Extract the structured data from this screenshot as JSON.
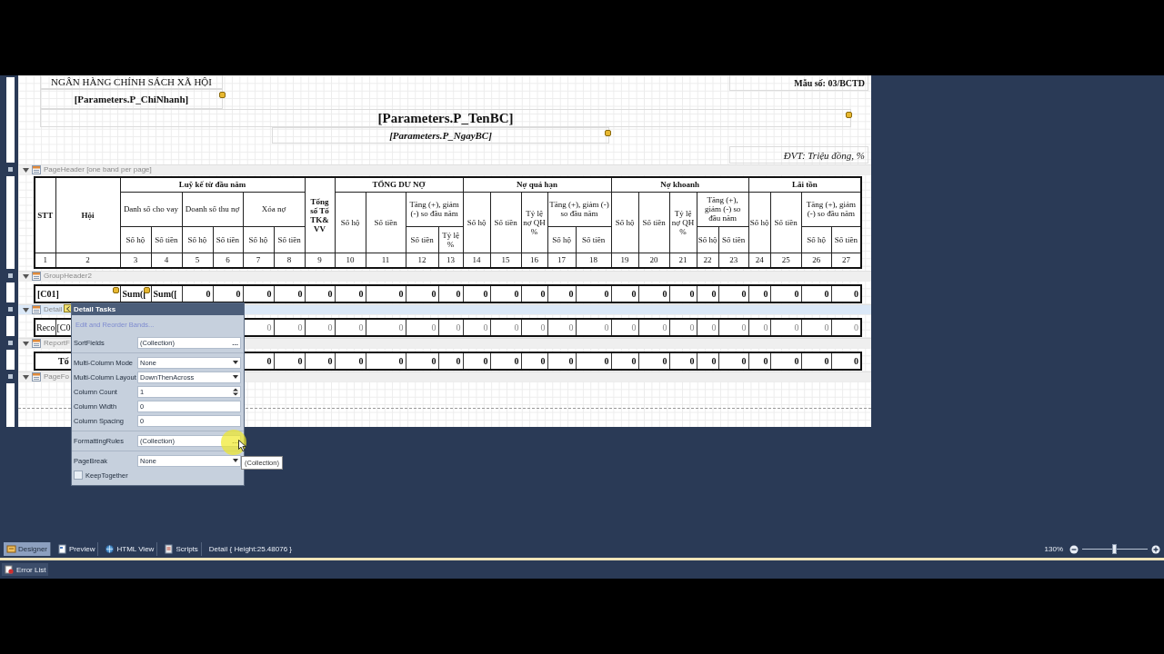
{
  "report_header": {
    "bank_name": "NGÂN HÀNG CHÍNH SÁCH XÃ HỘI",
    "branch": "[Parameters.P_ChiNhanh]",
    "form_number": "Mẫu số: 03/BCTD",
    "title": "[Parameters.P_TenBC]",
    "date": "[Parameters.P_NgayBC]",
    "unit": "ĐVT: Triệu đồng, %"
  },
  "table": {
    "columns": [
      {
        "label": "STT"
      },
      {
        "label": "Hội"
      },
      {
        "label": "Luỹ kế từ đầu năm",
        "children": [
          {
            "label": "Danh số cho vay",
            "children": [
              {
                "label": "Số hộ"
              },
              {
                "label": "Số tiền"
              }
            ]
          },
          {
            "label": "Doanh số thu nợ",
            "children": [
              {
                "label": "Số hộ"
              },
              {
                "label": "Số tiền"
              }
            ]
          },
          {
            "label": "Xóa nợ",
            "children": [
              {
                "label": "Số hộ"
              },
              {
                "label": "Số tiền"
              }
            ]
          }
        ]
      },
      {
        "label": "Tổng số Tổ TK& VV"
      },
      {
        "label": "TỔNG DƯ NỢ",
        "children": [
          {
            "label": "Số hộ"
          },
          {
            "label": "Số tiền"
          },
          {
            "label": "Tăng (+), giảm (-) so đầu năm",
            "children": [
              {
                "label": "Số tiền"
              },
              {
                "label": "Tỷ lệ %"
              }
            ]
          }
        ]
      },
      {
        "label": "Nợ quá hạn",
        "children": [
          {
            "label": "Số hộ"
          },
          {
            "label": "Số tiền"
          },
          {
            "label": "Tỷ lệ nợ QH %"
          },
          {
            "label": "Tăng (+), giảm (-) so đầu năm",
            "children": [
              {
                "label": "Số hộ"
              },
              {
                "label": "Số tiền"
              }
            ]
          }
        ]
      },
      {
        "label": "Nợ khoanh",
        "children": [
          {
            "label": "Số hộ"
          },
          {
            "label": "Số tiền"
          },
          {
            "label": "Tỷ lệ nợ QH %"
          },
          {
            "label": "Tăng (+), giảm (-) so đầu năm",
            "children": [
              {
                "label": "Số hộ"
              },
              {
                "label": "Số tiền"
              }
            ]
          }
        ]
      },
      {
        "label": "Lãi tồn",
        "children": [
          {
            "label": "Số hộ"
          },
          {
            "label": "Số tiền"
          },
          {
            "label": "Tăng (+), giảm (-) so đầu năm",
            "children": [
              {
                "label": "Số hộ"
              },
              {
                "label": "Số tiền"
              }
            ]
          }
        ]
      }
    ],
    "column_numbers": [
      "1",
      "2",
      "3",
      "4",
      "5",
      "6",
      "7",
      "8",
      "9",
      "10",
      "11",
      "12",
      "13",
      "14",
      "15",
      "16",
      "17",
      "18",
      "19",
      "20",
      "21",
      "22",
      "23",
      "24",
      "25",
      "26",
      "27"
    ]
  },
  "bands": [
    {
      "kind": "table",
      "title": "PageHeader [one band per page]",
      "expanded": true,
      "selected": false
    },
    {
      "kind": "group_row",
      "title": "GroupHeader2",
      "expanded": true,
      "selected": false,
      "row": {
        "lead": [
          "[C01]",
          "Sum([",
          "Sum(["
        ],
        "values": [
          "0",
          "0",
          "0",
          "0",
          "0",
          "0",
          "0",
          "0",
          "0",
          "0",
          "0",
          "0",
          "0",
          "0",
          "0",
          "0",
          "0",
          "0",
          "0",
          "0",
          "0",
          "0",
          "0"
        ]
      }
    },
    {
      "kind": "detail_row",
      "title": "Detail",
      "expanded": true,
      "selected": true,
      "row": {
        "lead": [
          "Reco",
          "[C0"
        ],
        "values": [
          "0",
          "0",
          "0",
          "0",
          "0",
          "0",
          "0",
          "0",
          "0",
          "0",
          "0",
          "0",
          "0",
          "0",
          "0",
          "0",
          "0",
          "0",
          "0",
          "0",
          "0"
        ]
      }
    },
    {
      "kind": "footer_row",
      "title": "ReportF",
      "expanded": true,
      "selected": false,
      "row": {
        "lead": [
          "Tổ"
        ],
        "values": [
          "0",
          "0",
          "0",
          "0",
          "0",
          "0",
          "0",
          "0",
          "0",
          "0",
          "0",
          "0",
          "0",
          "0",
          "0",
          "0",
          "0",
          "0",
          "0",
          "0",
          "0"
        ]
      }
    },
    {
      "kind": "empty",
      "title": "PageFo",
      "expanded": true,
      "selected": false
    }
  ],
  "detail_tasks": {
    "title": "Detail Tasks",
    "link": "Edit and Reorder Bands...",
    "groups": [
      {
        "properties": [
          {
            "kind": "collection",
            "label": "SortFields",
            "value": "(Collection)",
            "button": "..."
          }
        ]
      },
      {
        "properties": [
          {
            "kind": "dropdown",
            "label": "Multi-Column Mode",
            "value": "None"
          },
          {
            "kind": "dropdown",
            "label": "Multi-Column Layout",
            "value": "DownThenAcross"
          },
          {
            "kind": "spinner",
            "label": "Column Count",
            "value": "1"
          },
          {
            "kind": "text",
            "label": "Column Width",
            "value": "0"
          },
          {
            "kind": "text",
            "label": "Column Spacing",
            "value": "0"
          }
        ]
      },
      {
        "properties": [
          {
            "kind": "collection",
            "label": "FormattingRules",
            "value": "(Collection)",
            "button": "..."
          }
        ]
      },
      {
        "properties": [
          {
            "kind": "dropdown",
            "label": "PageBreak",
            "value": "None"
          },
          {
            "kind": "checkbox",
            "label": "KeepTogether",
            "checked": false
          }
        ]
      }
    ]
  },
  "tooltip": "(Collection)",
  "status_tabs": [
    {
      "label": "Designer",
      "selected": true
    },
    {
      "label": "Preview",
      "selected": false
    },
    {
      "label": "HTML View",
      "selected": false
    },
    {
      "label": "Scripts",
      "selected": false
    }
  ],
  "status_text": "Detail { Height:25.48076 }",
  "zoom": {
    "label": "130%",
    "level": 0.48
  },
  "error_tab": {
    "label": "Error List"
  }
}
